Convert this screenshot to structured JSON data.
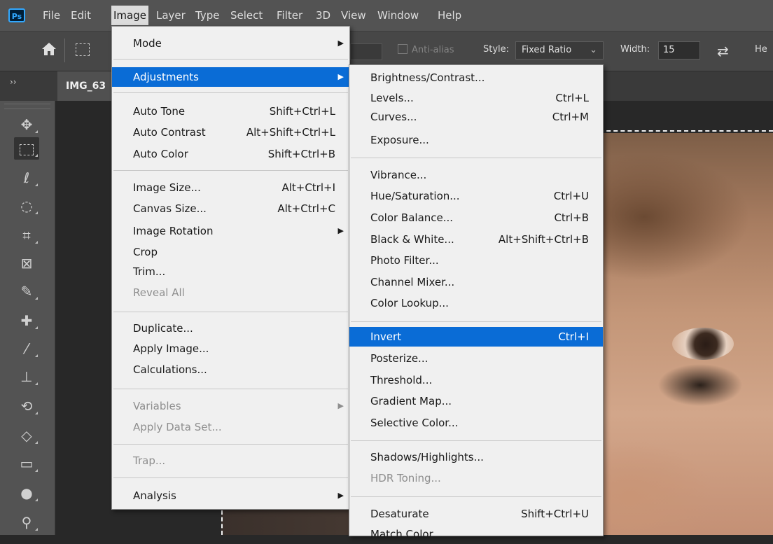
{
  "app": {
    "logo": "Ps"
  },
  "menubar": {
    "items": [
      "File",
      "Edit",
      "Image",
      "Layer",
      "Type",
      "Select",
      "Filter",
      "3D",
      "View",
      "Window",
      "Help"
    ],
    "active": "Image"
  },
  "options": {
    "antialias": "Anti-alias",
    "style_label": "Style:",
    "style_value": "Fixed Ratio",
    "width_label": "Width:",
    "width_value": "15",
    "height_label": "He"
  },
  "tab": {
    "collapse": "››",
    "doc_name": "IMG_63"
  },
  "tools": [
    "move-tool",
    "marquee-tool",
    "lasso-tool",
    "quick-select-tool",
    "crop-tool",
    "frame-tool",
    "eyedropper-tool",
    "healing-brush-tool",
    "brush-tool",
    "clone-stamp-tool",
    "history-brush-tool",
    "eraser-tool",
    "gradient-tool",
    "blur-tool",
    "dodge-tool"
  ],
  "image_menu": {
    "mode": "Mode",
    "adjustments": "Adjustments",
    "auto_tone": "Auto Tone",
    "auto_tone_sc": "Shift+Ctrl+L",
    "auto_contrast": "Auto Contrast",
    "auto_contrast_sc": "Alt+Shift+Ctrl+L",
    "auto_color": "Auto Color",
    "auto_color_sc": "Shift+Ctrl+B",
    "image_size": "Image Size...",
    "image_size_sc": "Alt+Ctrl+I",
    "canvas_size": "Canvas Size...",
    "canvas_size_sc": "Alt+Ctrl+C",
    "image_rotation": "Image Rotation",
    "crop": "Crop",
    "trim": "Trim...",
    "reveal_all": "Reveal All",
    "duplicate": "Duplicate...",
    "apply_image": "Apply Image...",
    "calculations": "Calculations...",
    "variables": "Variables",
    "apply_data_set": "Apply Data Set...",
    "trap": "Trap...",
    "analysis": "Analysis"
  },
  "adjustments_menu": {
    "brightness_contrast": "Brightness/Contrast...",
    "levels": "Levels...",
    "levels_sc": "Ctrl+L",
    "curves": "Curves...",
    "curves_sc": "Ctrl+M",
    "exposure": "Exposure...",
    "vibrance": "Vibrance...",
    "hue_saturation": "Hue/Saturation...",
    "hue_saturation_sc": "Ctrl+U",
    "color_balance": "Color Balance...",
    "color_balance_sc": "Ctrl+B",
    "black_white": "Black & White...",
    "black_white_sc": "Alt+Shift+Ctrl+B",
    "photo_filter": "Photo Filter...",
    "channel_mixer": "Channel Mixer...",
    "color_lookup": "Color Lookup...",
    "invert": "Invert",
    "invert_sc": "Ctrl+I",
    "posterize": "Posterize...",
    "threshold": "Threshold...",
    "gradient_map": "Gradient Map...",
    "selective_color": "Selective Color...",
    "shadows_highlights": "Shadows/Highlights...",
    "hdr_toning": "HDR Toning...",
    "desaturate": "Desaturate",
    "desaturate_sc": "Shift+Ctrl+U",
    "match_color": "Match Color..."
  },
  "colors": {
    "highlight": "#0a6cd6",
    "menu_bg": "#f0f0f0",
    "chrome": "#535353"
  }
}
